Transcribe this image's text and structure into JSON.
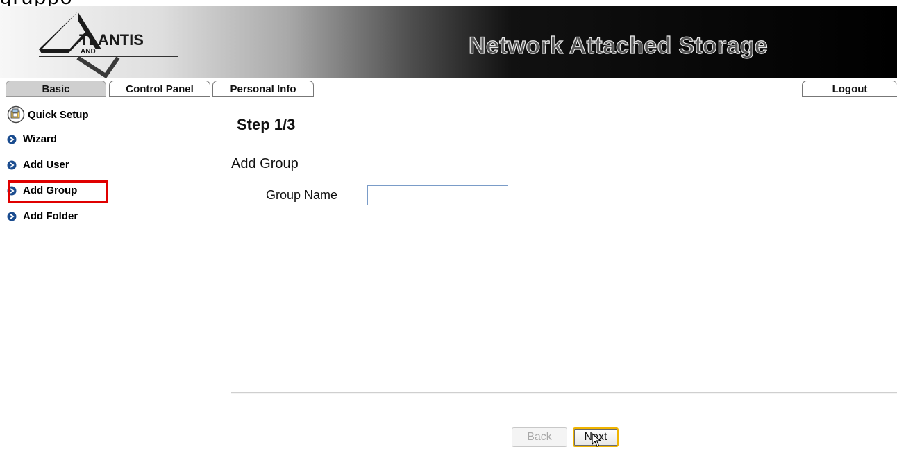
{
  "page_top_text": "gruppo",
  "header": {
    "logo": {
      "name": "atlantis-logo",
      "text": "TLANTIS",
      "sub": "AND"
    },
    "title": "Network Attached Storage"
  },
  "tabs": [
    {
      "label": "Basic",
      "active": true
    },
    {
      "label": "Control Panel",
      "active": false
    },
    {
      "label": "Personal Info",
      "active": false
    }
  ],
  "logout_label": "Logout",
  "sidebar": {
    "title": "Quick Setup",
    "title_icon": "quick-setup-icon",
    "items": [
      {
        "label": "Wizard",
        "icon": "arrow-bullet-icon"
      },
      {
        "label": "Add User",
        "icon": "arrow-bullet-icon"
      },
      {
        "label": "Add Group",
        "icon": "arrow-bullet-icon",
        "highlighted": true
      },
      {
        "label": "Add Folder",
        "icon": "arrow-bullet-icon"
      }
    ]
  },
  "main": {
    "step_title": "Step 1/3",
    "section_title": "Add Group",
    "group_name_label": "Group Name",
    "group_name_value": "",
    "group_name_placeholder": ""
  },
  "buttons": {
    "back_label": "Back",
    "back_disabled": true,
    "next_label": "Next"
  },
  "colors": {
    "highlight": "#e00000",
    "bullet_icon": "#1a4c8f",
    "active_tab": "#cfcfcf",
    "input_border": "#7a9cc8",
    "next_focus_border": "#f0b400"
  }
}
